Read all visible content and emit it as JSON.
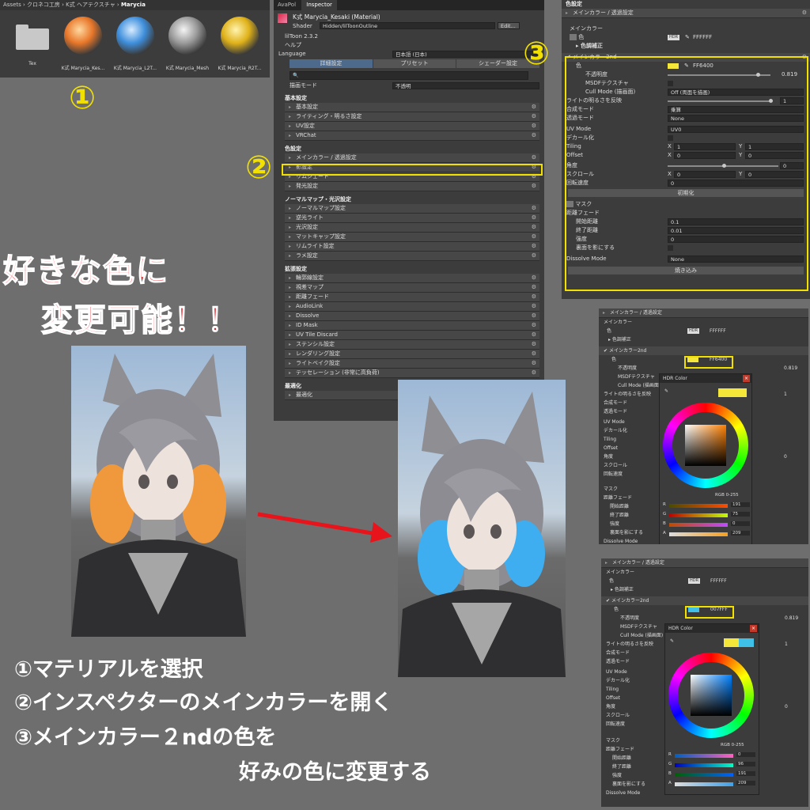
{
  "project": {
    "breadcrumb": [
      "Assets",
      "クロネコ工房",
      "K式 ヘアテクスチャ",
      "Marycia"
    ],
    "items": [
      {
        "label": "Tex",
        "kind": "folder"
      },
      {
        "label": "K式 Marycia_Kes...",
        "kind": "orange"
      },
      {
        "label": "K式 Marycia_L2T...",
        "kind": "blue"
      },
      {
        "label": "K式 Marycia_Mesh",
        "kind": "silver"
      },
      {
        "label": "K式 Marycia_R2T...",
        "kind": "gold"
      }
    ]
  },
  "inspector": {
    "tabs": [
      "AvaPol",
      "Inspector"
    ],
    "material_title": "K式 Marycia_Kesaki (Material)",
    "shader_label": "Shader",
    "shader_value": "Hidden/lilToonOutline",
    "edit_label": "Edit...",
    "version": "lilToon 2.3.2",
    "help": "ヘルプ",
    "language_label": "Language",
    "language_value": "日本語 (日本)",
    "mode_tabs": [
      "詳細設定",
      "プリセット",
      "シェーダー設定"
    ],
    "render_mode_label": "描画モード",
    "render_mode_value": "不透明",
    "sections": [
      {
        "title": "基本設定",
        "items": [
          "基本設定",
          "ライティング・明るさ設定",
          "UV設定",
          "VRChat"
        ]
      },
      {
        "title": "色設定",
        "items": [
          "メインカラー / 透過設定",
          "影設定",
          "リムシェード",
          "発光設定"
        ]
      },
      {
        "title": "ノーマルマップ・光沢設定",
        "items": [
          "ノーマルマップ設定",
          "逆光ライト",
          "光沢設定",
          "マットキャップ設定",
          "リムライト設定",
          "ラメ設定"
        ]
      },
      {
        "title": "拡張設定",
        "items": [
          "輪郭線設定",
          "視差マップ",
          "距離フェード",
          "AudioLink",
          "Dissolve",
          "ID Mask",
          "UV Tile Discard",
          "ステンシル設定",
          "レンダリング設定",
          "ライトベイク設定",
          "テッセレーション (非常に高負荷)"
        ]
      },
      {
        "title": "最適化",
        "items": [
          "最適化"
        ]
      }
    ]
  },
  "maincolor_panel": {
    "header": "色設定",
    "fold_title": "メインカラー / 透過設定",
    "main_color_section": "メインカラー",
    "color_label": "色",
    "hdr": "HDR",
    "main_hex": "FFFFFF",
    "color_correction": "色調補正",
    "second_title": "メインカラー2nd",
    "second_hex": "FF6400",
    "second_color_swatch": "#f5e63a",
    "opacity_label": "不透明度",
    "opacity_value": "0.819",
    "msdf_label": "MSDFテクスチャ",
    "cull_label": "Cull Mode (描画面)",
    "cull_value": "Off (両面を描画)",
    "light_label": "ライトの明るさを反映",
    "light_value": "1",
    "blend_label": "合成モード",
    "blend_value": "乗算",
    "alpha_label": "透過モード",
    "alpha_value": "None",
    "uv_label": "UV Mode",
    "uv_value": "UV0",
    "decal_label": "デカール化",
    "tiling_label": "Tiling",
    "tiling_x": "1",
    "tiling_y": "1",
    "offset_label": "Offset",
    "offset_x": "0",
    "offset_y": "0",
    "angle_label": "角度",
    "angle_value": "0",
    "scroll_label": "スクロール",
    "scroll_x": "0",
    "scroll_y": "0",
    "rotate_label": "回転速度",
    "rotate_value": "0",
    "init_label": "初期化",
    "mask_label": "マスク",
    "distfade_label": "距離フェード",
    "start_label": "開始距離",
    "start_value": "0.1",
    "end_label": "終了距離",
    "end_value": "0.01",
    "strength_label": "強度",
    "strength_value": "0",
    "backface_label": "裏面を影にする",
    "dissolve_label": "Dissolve Mode",
    "dissolve_value": "None",
    "bake_label": "焼き込み"
  },
  "picker1": {
    "title": "HDR Color",
    "hex": "FF6400",
    "swatch": "#f5e63a",
    "mode": "RGB 0-255",
    "r": "191",
    "g": "75",
    "b": "0",
    "a": "209",
    "labels": {
      "header": "メインカラー / 透過設定",
      "main": "メインカラー",
      "color": "色",
      "hdr": "HDR",
      "main_hex": "FFFFFF",
      "correction": "色調補正",
      "second": "メインカラー2nd",
      "opacity": "不透明度",
      "opacity_v": "0.819",
      "msdf": "MSDFテクスチャ",
      "cull": "Cull Mode (描画面)",
      "light": "ライトの明るさを反映",
      "light_v": "1",
      "blend": "合成モード",
      "alpha": "透過モード",
      "uv": "UV Mode",
      "decal": "デカール化",
      "tiling": "Tiling",
      "offset": "Offset",
      "angle": "角度",
      "angle_v": "0",
      "scroll": "スクロール",
      "rotate": "回転速度",
      "mask": "マスク",
      "fade": "距離フェード",
      "start": "開始距離",
      "end": "終了距離",
      "strength": "強度",
      "backface": "裏面を影にする",
      "dissolve": "Dissolve Mode"
    }
  },
  "picker2": {
    "title": "HDR Color",
    "hex": "007FFF",
    "swatch": "#3fc0e8",
    "mode": "RGB 0-255",
    "r": "0",
    "g": "96",
    "b": "191",
    "a": "209"
  },
  "callouts": {
    "n1": "①",
    "n2": "②",
    "n3": "③",
    "headline1": "好きな色に",
    "headline2": "変更可能！！",
    "step1": "①マテリアルを選択",
    "step2": "②インスペクターのメインカラーを開く",
    "step3": "③メインカラー２ndの色を",
    "step3b": "好みの色に変更する"
  },
  "colors": {
    "accent_yellow": "#f2e100",
    "headline_red": "#e8141b",
    "arrow_red": "#e8141b"
  }
}
